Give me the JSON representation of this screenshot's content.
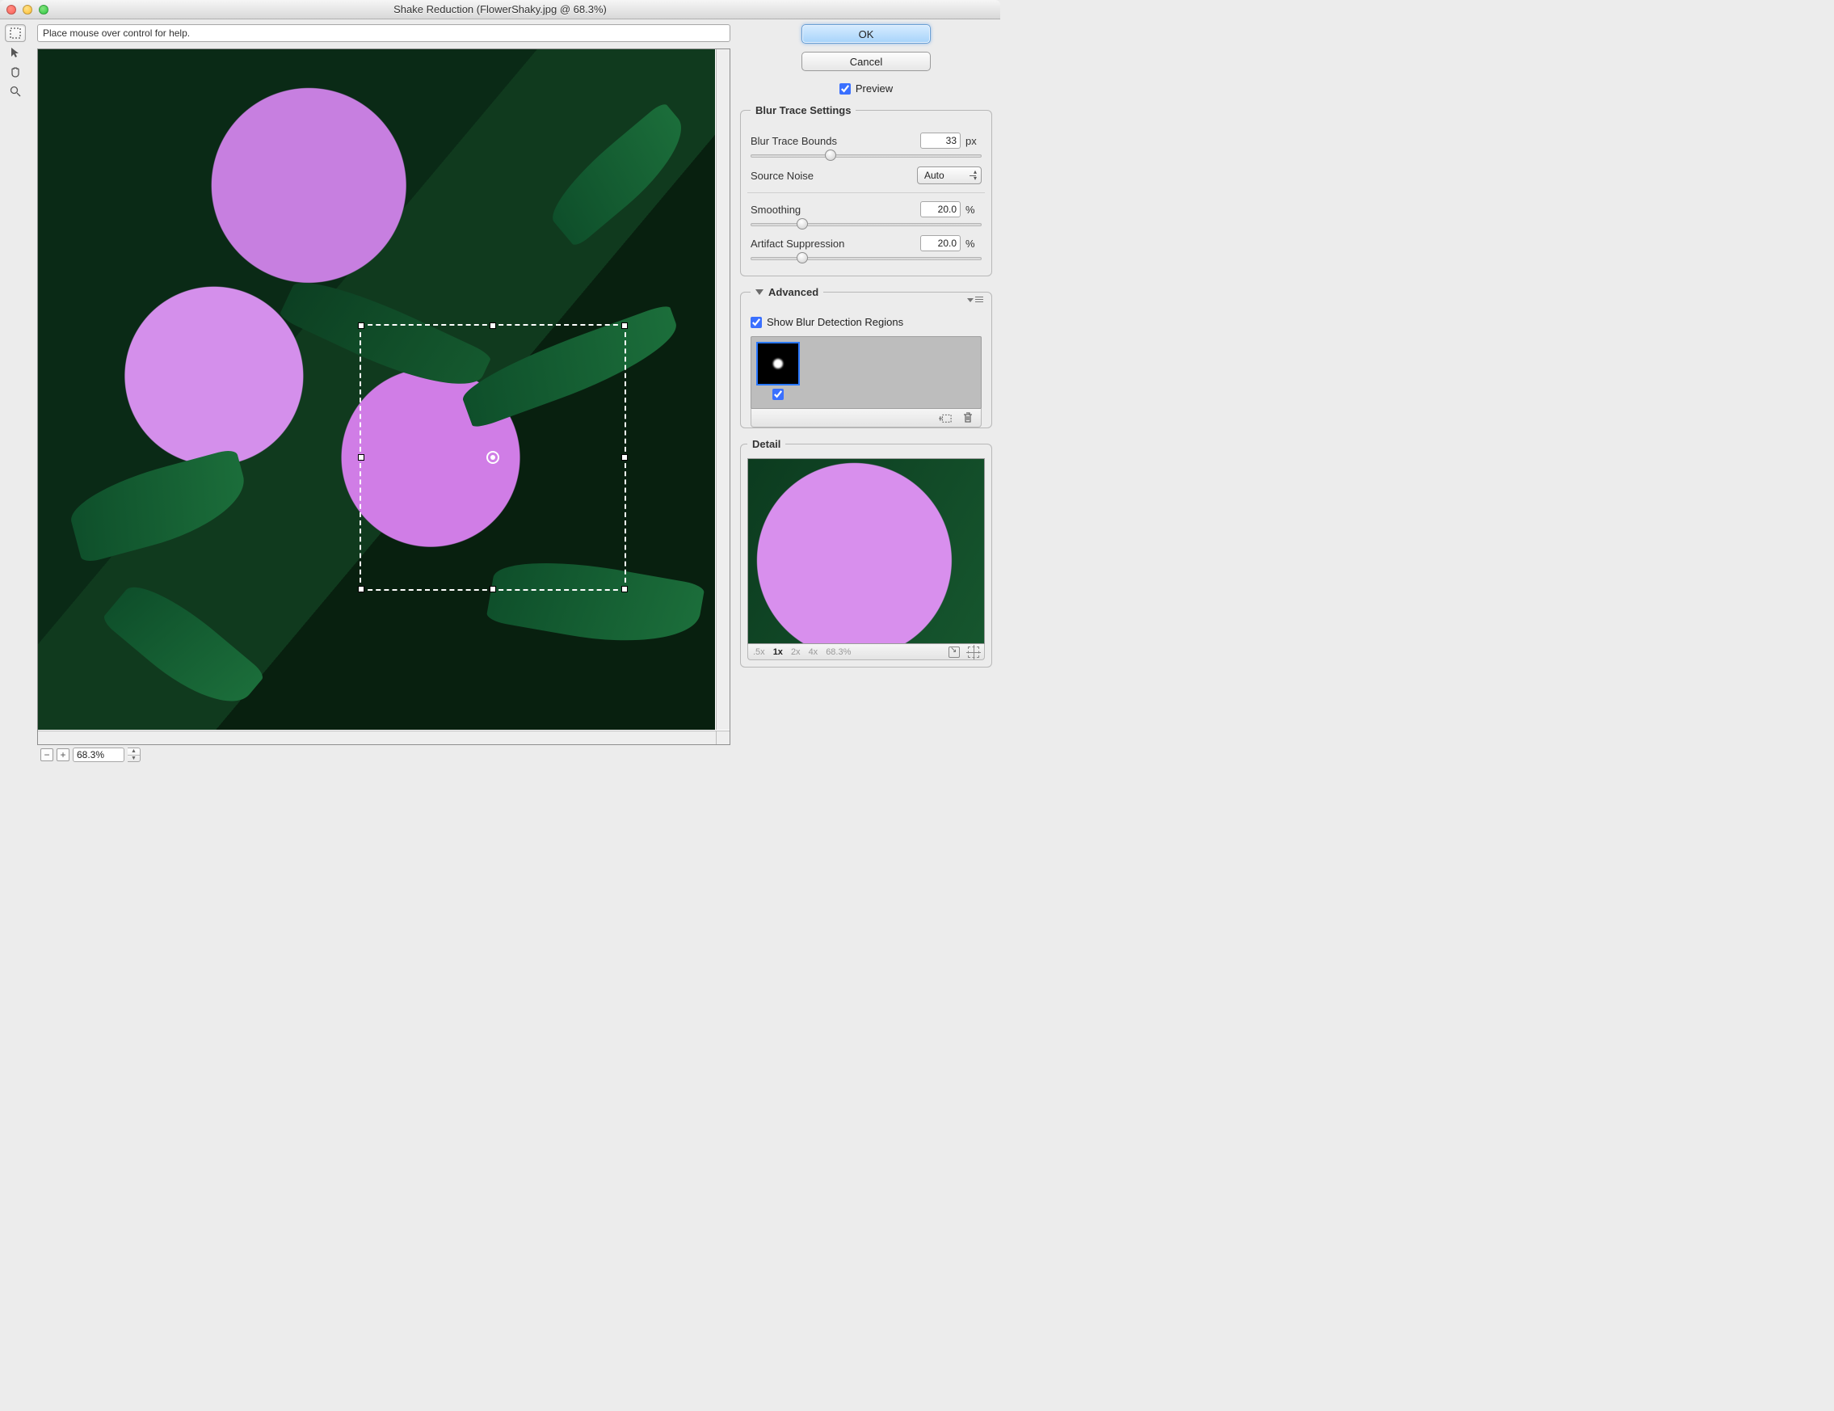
{
  "window": {
    "title": "Shake Reduction (FlowerShaky.jpg @ 68.3%)"
  },
  "help": {
    "text": "Place mouse over control for help."
  },
  "zoom": {
    "value": "68.3%"
  },
  "buttons": {
    "ok": "OK",
    "cancel": "Cancel"
  },
  "preview": {
    "label": "Preview",
    "checked": true
  },
  "blur_trace": {
    "legend": "Blur Trace Settings",
    "bounds_label": "Blur Trace Bounds",
    "bounds_value": "33",
    "bounds_unit": "px",
    "bounds_pos_pct": 32,
    "source_noise_label": "Source Noise",
    "source_noise_value": "Auto",
    "smoothing_label": "Smoothing",
    "smoothing_value": "20.0",
    "smoothing_unit": "%",
    "smoothing_pos_pct": 20,
    "artifact_label": "Artifact Suppression",
    "artifact_value": "20.0",
    "artifact_unit": "%",
    "artifact_pos_pct": 20
  },
  "advanced": {
    "legend": "Advanced",
    "show_regions_label": "Show Blur Detection Regions",
    "show_regions_checked": true,
    "region_checked": true
  },
  "detail": {
    "legend": "Detail",
    "zoom_levels": [
      ".5x",
      "1x",
      "2x",
      "4x",
      "68.3%"
    ],
    "selected_index": 1
  },
  "tools": {
    "selection": "blur-estimation-tool",
    "pointer": "direct-selection-tool",
    "hand": "hand-tool",
    "zoom": "zoom-tool"
  }
}
